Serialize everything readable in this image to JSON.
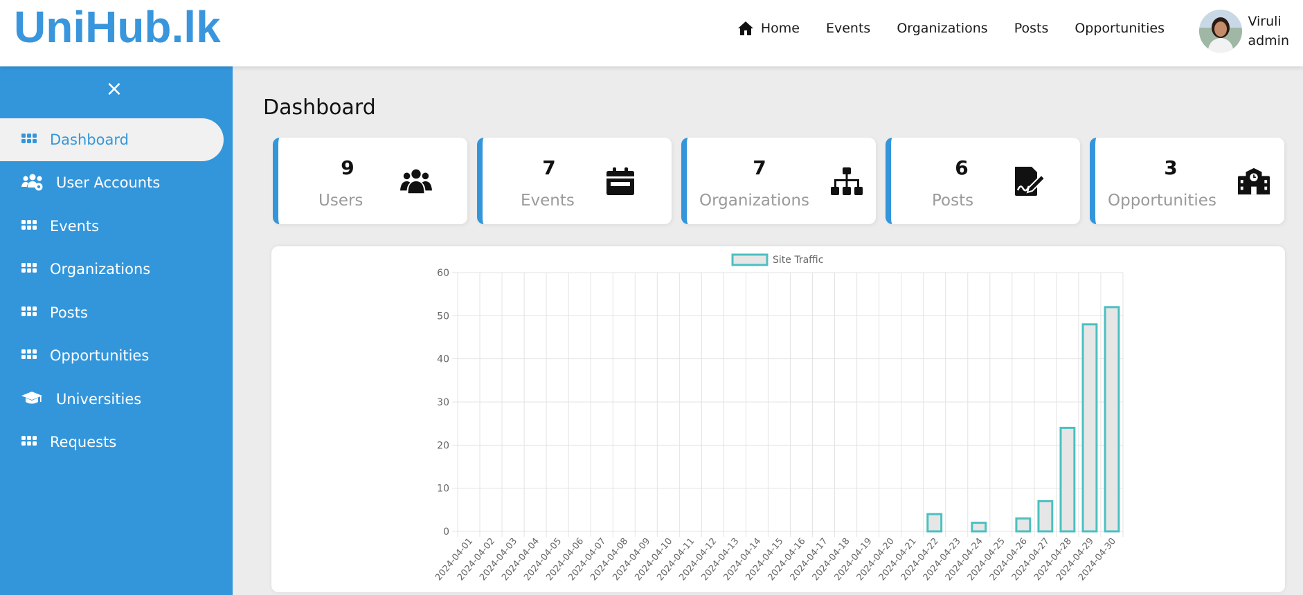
{
  "brand": {
    "name": "UniHub.lk"
  },
  "nav": {
    "home": "Home",
    "events": "Events",
    "organizations": "Organizations",
    "posts": "Posts",
    "opportunities": "Opportunities"
  },
  "profile": {
    "name": "Viruli",
    "role": "admin"
  },
  "sidebar": {
    "close_icon": "×",
    "items": [
      {
        "label": "Dashboard",
        "icon": "grid-icon",
        "active": true
      },
      {
        "label": "User Accounts",
        "icon": "users-gear-icon"
      },
      {
        "label": "Events",
        "icon": "grid-icon"
      },
      {
        "label": "Organizations",
        "icon": "grid-icon"
      },
      {
        "label": "Posts",
        "icon": "grid-icon"
      },
      {
        "label": "Opportunities",
        "icon": "grid-icon"
      },
      {
        "label": "Universities",
        "icon": "graduation-cap-icon"
      },
      {
        "label": "Requests",
        "icon": "grid-icon"
      }
    ]
  },
  "page": {
    "title": "Dashboard"
  },
  "stats": [
    {
      "value": "9",
      "label": "Users",
      "icon": "users-icon"
    },
    {
      "value": "7",
      "label": "Events",
      "icon": "calendar-icon"
    },
    {
      "value": "7",
      "label": "Organizations",
      "icon": "sitemap-icon"
    },
    {
      "value": "6",
      "label": "Posts",
      "icon": "file-signature-icon"
    },
    {
      "value": "3",
      "label": "Opportunities",
      "icon": "school-icon"
    }
  ],
  "colors": {
    "accent": "#3396db",
    "bar_border": "#4bc0c0",
    "bar_fill": "#e6e6e6"
  },
  "chart_data": {
    "type": "bar",
    "legend": "Site Traffic",
    "categories": [
      "2024-04-01",
      "2024-04-02",
      "2024-04-03",
      "2024-04-04",
      "2024-04-05",
      "2024-04-06",
      "2024-04-07",
      "2024-04-08",
      "2024-04-09",
      "2024-04-10",
      "2024-04-11",
      "2024-04-12",
      "2024-04-13",
      "2024-04-14",
      "2024-04-15",
      "2024-04-16",
      "2024-04-17",
      "2024-04-18",
      "2024-04-19",
      "2024-04-20",
      "2024-04-21",
      "2024-04-22",
      "2024-04-23",
      "2024-04-24",
      "2024-04-25",
      "2024-04-26",
      "2024-04-27",
      "2024-04-28",
      "2024-04-29",
      "2024-04-30"
    ],
    "values": [
      0,
      0,
      0,
      0,
      0,
      0,
      0,
      0,
      0,
      0,
      0,
      0,
      0,
      0,
      0,
      0,
      0,
      0,
      0,
      0,
      0,
      4,
      0,
      2,
      0,
      3,
      7,
      24,
      48,
      52
    ],
    "ylim": [
      0,
      60
    ],
    "yticks": [
      0,
      10,
      20,
      30,
      40,
      50,
      60
    ],
    "grid": true,
    "legend_position": "top-center"
  }
}
